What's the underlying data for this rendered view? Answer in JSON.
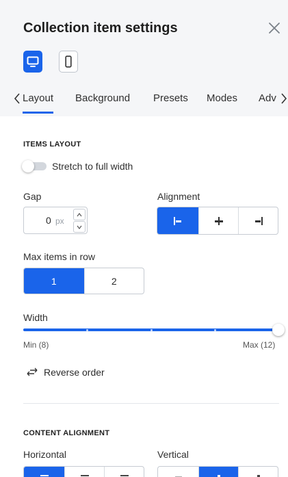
{
  "header": {
    "title": "Collection item settings",
    "close_icon": "close-icon"
  },
  "devices": [
    {
      "name": "desktop",
      "icon": "desktop-icon",
      "active": true
    },
    {
      "name": "mobile",
      "icon": "mobile-icon",
      "active": false
    }
  ],
  "tabs": {
    "items": [
      "Layout",
      "Background",
      "Presets",
      "Modes",
      "Adv"
    ],
    "active": "Layout",
    "scroll_left_icon": "chevron-left-icon",
    "scroll_right_icon": "chevron-right-icon"
  },
  "items_layout": {
    "title": "ITEMS LAYOUT",
    "stretch": {
      "label": "Stretch to full width",
      "enabled": false
    },
    "gap": {
      "label": "Gap",
      "value": "0",
      "unit": "px"
    },
    "alignment": {
      "label": "Alignment",
      "options": [
        "align-left-icon",
        "align-center-icon",
        "align-right-icon"
      ],
      "active_index": 0
    },
    "max_items": {
      "label": "Max items in row",
      "options": [
        "1",
        "2"
      ],
      "active_index": 0
    },
    "width": {
      "label": "Width",
      "min_label": "Min (8)",
      "max_label": "Max (12)",
      "min": 8,
      "max": 12,
      "value": 12
    },
    "reverse": {
      "label": "Reverse order",
      "icon": "swap-arrows-icon"
    }
  },
  "content_alignment": {
    "title": "CONTENT ALIGNMENT",
    "horizontal": {
      "label": "Horizontal",
      "active_index": 0
    },
    "vertical": {
      "label": "Vertical",
      "active_index": 1
    }
  },
  "colors": {
    "accent": "#1a64ea",
    "header_bg": "#f5f6f8"
  }
}
